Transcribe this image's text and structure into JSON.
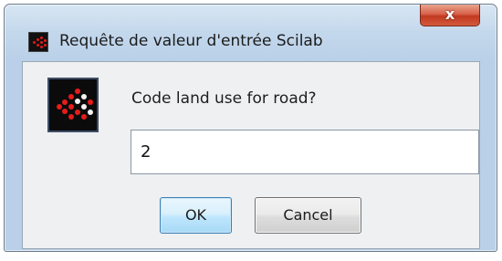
{
  "window": {
    "title": "Requête de valeur d'entrée Scilab",
    "close_label": "x",
    "app_icon": "scilab-icon"
  },
  "dialog": {
    "prompt": "Code land use for road?",
    "input_value": "2",
    "prompt_icon": "scilab-icon",
    "ok_label": "OK",
    "cancel_label": "Cancel"
  },
  "colors": {
    "frame": "#c4d8ec",
    "close_button": "#c0391f",
    "ok_border": "#3c7fb1",
    "icon_red": "#e81b1b"
  }
}
